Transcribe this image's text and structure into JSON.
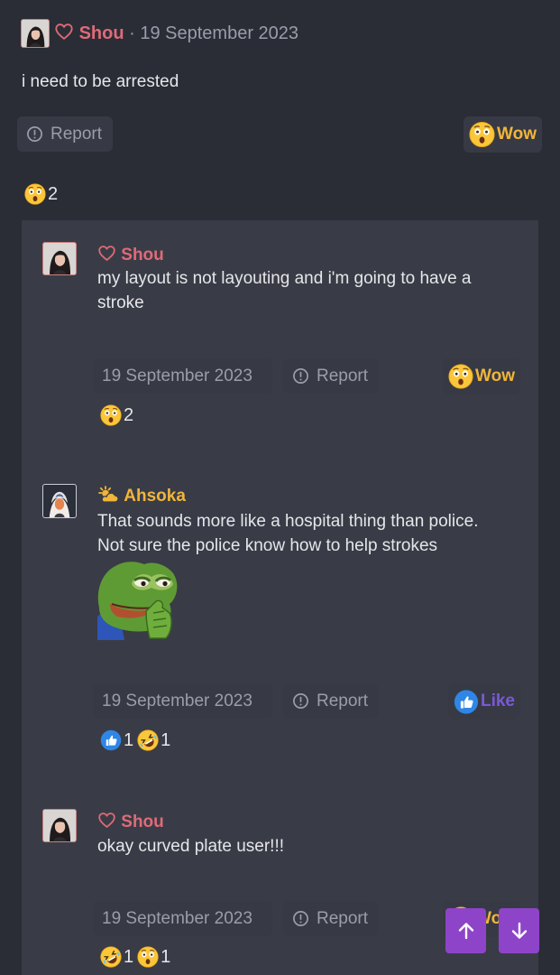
{
  "post": {
    "author": "Shou",
    "separator": "·",
    "date": "19 September 2023",
    "text": "i need to be arrested",
    "report_label": "Report",
    "reaction_label": "Wow",
    "counts": [
      {
        "emoji": "astonished-emoji",
        "count": "2"
      }
    ]
  },
  "replies": [
    {
      "author": "Shou",
      "text_line1": "my layout is not layouting and i'm going to have a",
      "text_line2": "stroke",
      "date": "19 September 2023",
      "report_label": "Report",
      "reaction_label": "Wow",
      "counts": [
        {
          "emoji": "astonished-emoji",
          "count": "2"
        }
      ]
    },
    {
      "author": "Ahsoka",
      "text_line1": "That sounds more like a hospital thing than police.",
      "text_line2": "Not sure the police know how to help strokes",
      "date": "19 September 2023",
      "report_label": "Report",
      "reaction_label": "Like",
      "counts": [
        {
          "emoji": "thumbs-up-emoji",
          "count": "1"
        },
        {
          "emoji": "rofl-emoji",
          "count": "1"
        }
      ]
    },
    {
      "author": "Shou",
      "text_line1": "okay curved plate user!!!",
      "date": "19 September 2023",
      "report_label": "Report",
      "reaction_label": "Wow",
      "counts": [
        {
          "emoji": "rofl-emoji",
          "count": "1"
        },
        {
          "emoji": "astonished-emoji",
          "count": "1"
        }
      ]
    }
  ],
  "colors": {
    "background": "#2a2d36",
    "panel": "#393c46",
    "button": "#373a44",
    "shou_name": "#e06a78",
    "ahsoka_name": "#f1b53a",
    "wow_label": "#f1b53a",
    "like_label": "#7b58d8",
    "scroll_button": "#8e44c9"
  },
  "icons": [
    "heart-icon",
    "sun-behind-cloud-icon",
    "info-icon",
    "arrow-up-icon",
    "arrow-down-icon"
  ]
}
